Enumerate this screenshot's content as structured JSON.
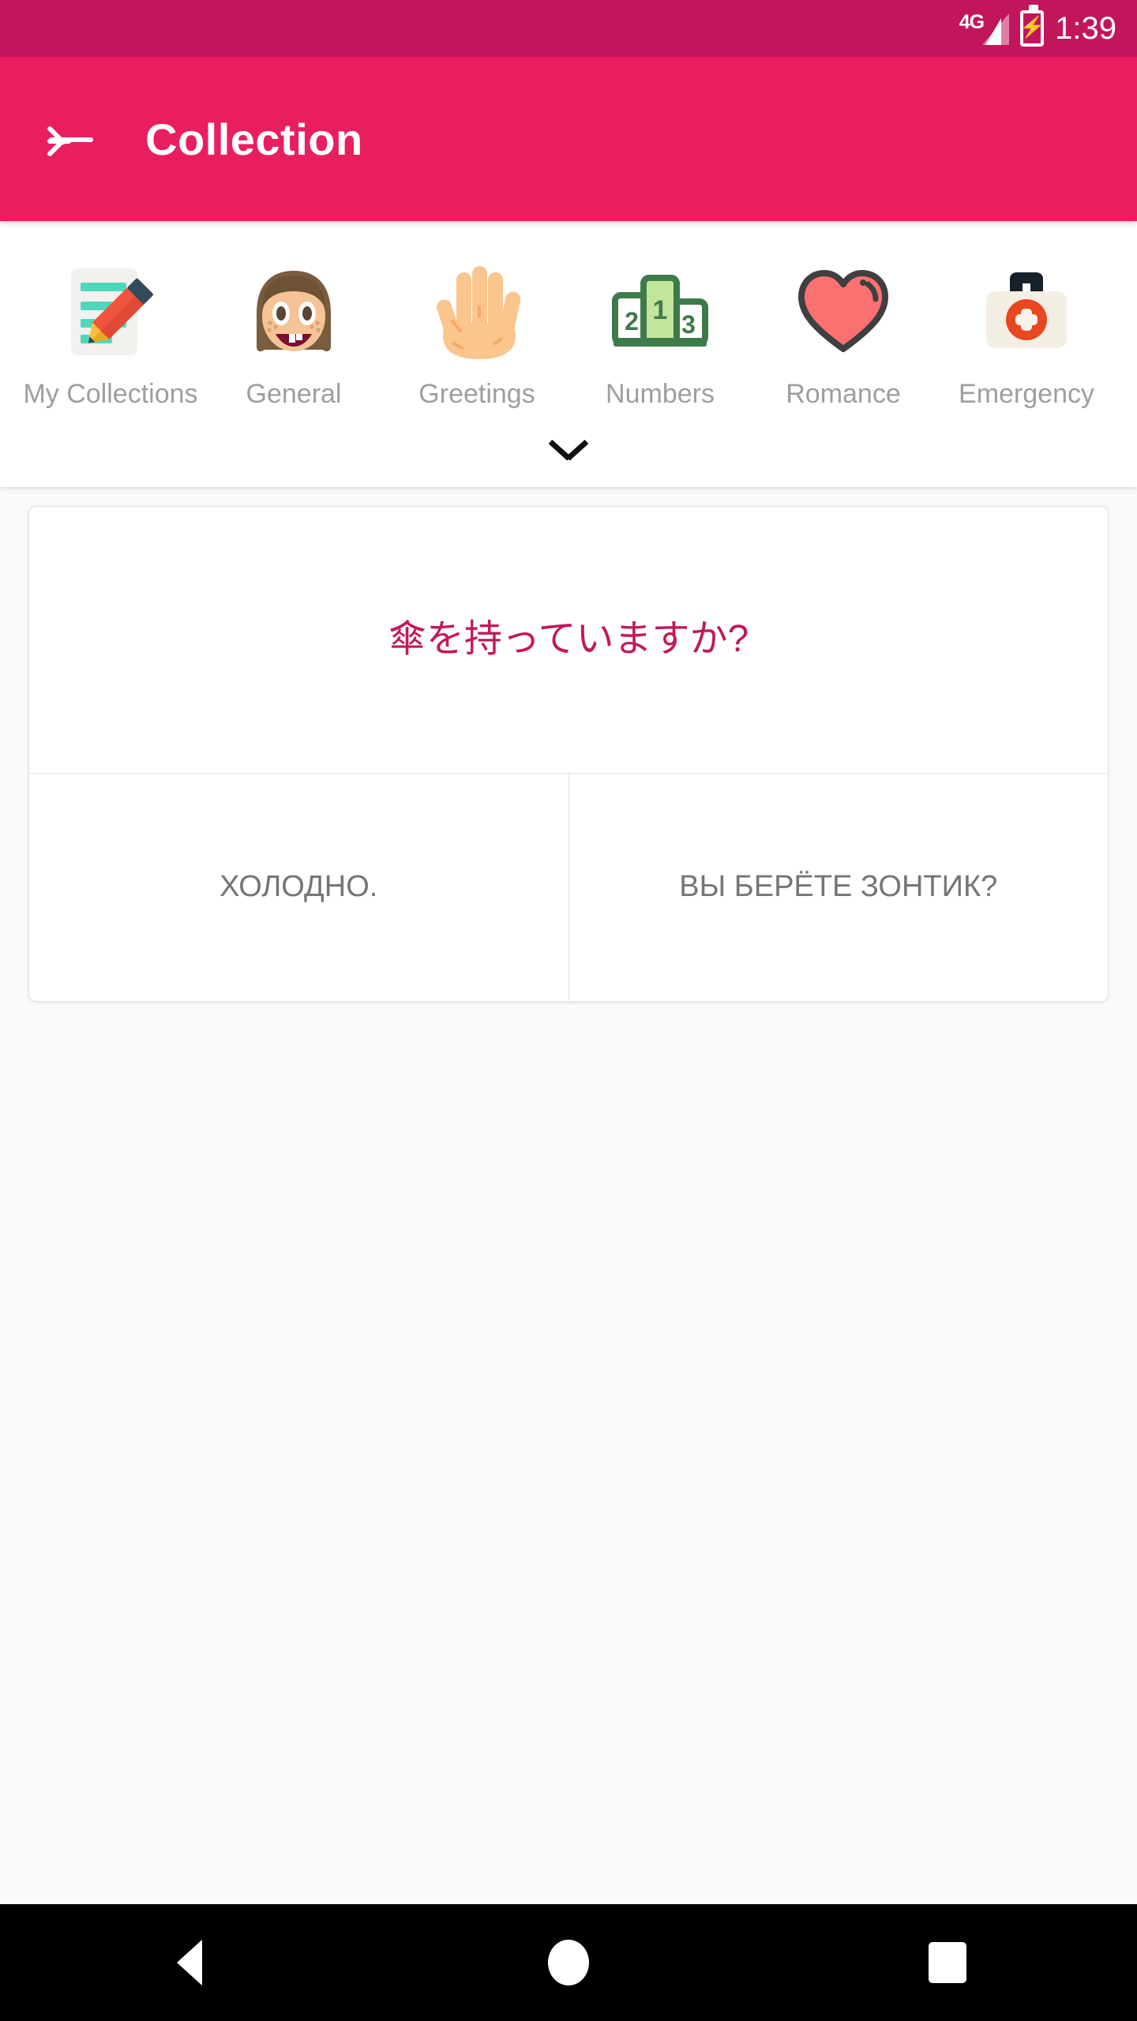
{
  "status_bar": {
    "network": "4G",
    "battery_icon": "battery-charging-icon",
    "time": "1:39",
    "background_color": "#c2165c"
  },
  "app_bar": {
    "back_icon": "arrow-left-icon",
    "title": "Collection",
    "background_color": "#e91e5f"
  },
  "categories": {
    "items": [
      {
        "label": "My Collections",
        "icon": "memo-pencil-icon"
      },
      {
        "label": "General",
        "icon": "girl-face-icon"
      },
      {
        "label": "Greetings",
        "icon": "raised-hand-icon"
      },
      {
        "label": "Numbers",
        "icon": "podium-icon"
      },
      {
        "label": "Romance",
        "icon": "heart-icon"
      },
      {
        "label": "Emergency",
        "icon": "first-aid-kit-icon"
      }
    ],
    "expander_icon": "chevron-down-icon",
    "label_color": "#9e9e9e"
  },
  "phrase_card": {
    "question": "傘を持っていますか?",
    "question_color": "#c2185b",
    "options": [
      "ХОЛОДНО.",
      "ВЫ БЕРЁТЕ ЗОНТИК?"
    ],
    "option_color": "#757575"
  },
  "nav_bar": {
    "back": "triangle-back-icon",
    "home": "circle-home-icon",
    "recents": "square-recents-icon"
  }
}
